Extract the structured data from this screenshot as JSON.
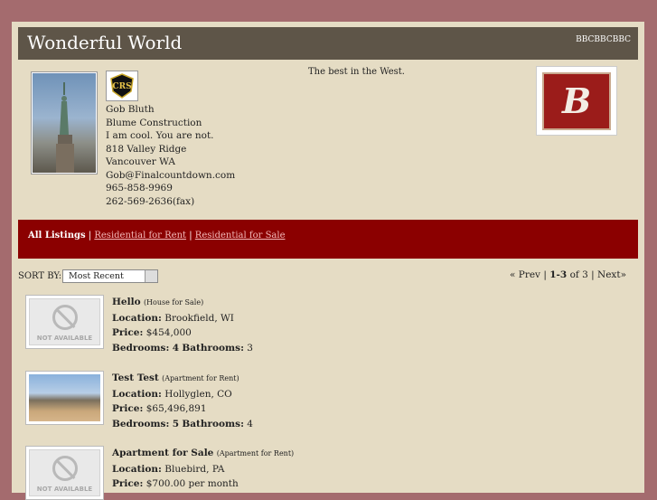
{
  "header": {
    "title": "Wonderful World",
    "links": "BBCBBCBBC"
  },
  "agent": {
    "tagline": "The best in the West.",
    "name": "Gob Bluth",
    "company": "Blume Construction",
    "motto": "I am cool. You are not.",
    "street": "818 Valley Ridge",
    "city": "Vancouver WA",
    "email": "Gob@Finalcountdown.com",
    "phone": "965-858-9969",
    "fax": "262-569-2636(fax)",
    "crs_logo": "CRS",
    "brand_letter": "B"
  },
  "listing_nav": {
    "active": "All Listings",
    "sep": "|",
    "rent": "Residential for Rent",
    "sale": "Residential for Sale"
  },
  "sort": {
    "label": "SORT BY:",
    "selected": "Most Recent"
  },
  "pager": {
    "prev": "« Prev",
    "range": "1-3",
    "of": "of 3",
    "next": "Next»",
    "sep": "|"
  },
  "labels": {
    "location": "Location:",
    "price": "Price:",
    "bedrooms": "Bedrooms:",
    "bathrooms": "Bathrooms:"
  },
  "listings": [
    {
      "title": "Hello",
      "type": "(House for Sale)",
      "location": "Brookfield, WI",
      "price": "$454,000",
      "bedrooms": "4",
      "bathrooms": "3",
      "image": "NOT AVAILABLE"
    },
    {
      "title": "Test Test",
      "type": "(Apartment for Rent)",
      "location": "Hollyglen, CO",
      "price": "$65,496,891",
      "bedrooms": "5",
      "bathrooms": "4",
      "image": ""
    },
    {
      "title": "Apartment for Sale",
      "type": "(Apartment for Rent)",
      "location": "Bluebird, PA",
      "price": "$700.00 per month",
      "image": "NOT AVAILABLE"
    }
  ]
}
